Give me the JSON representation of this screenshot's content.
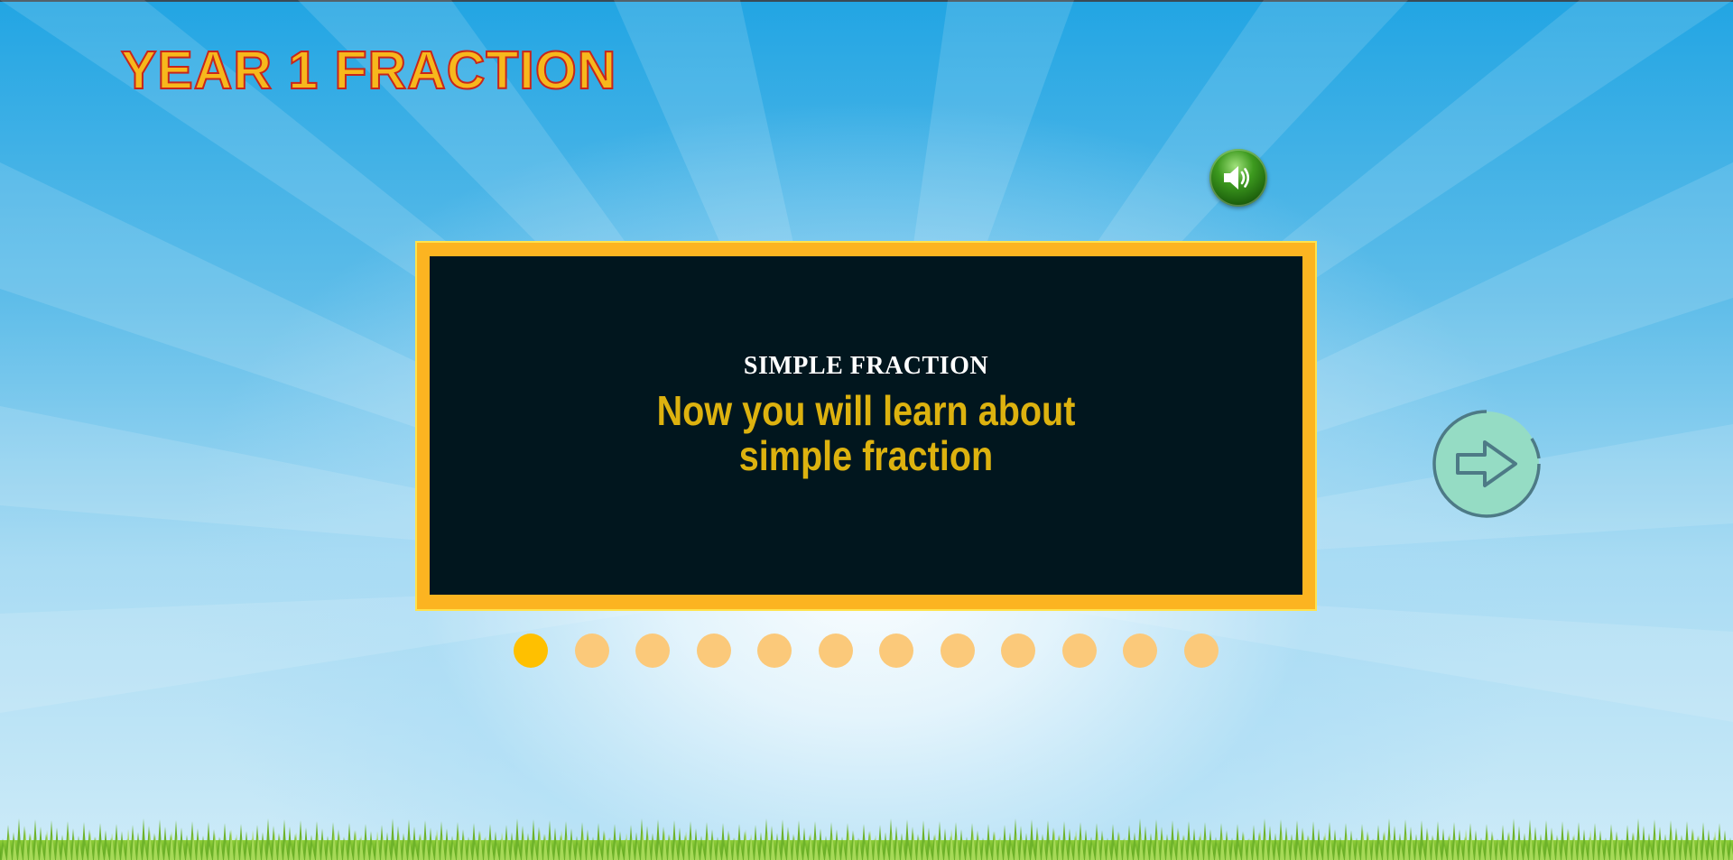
{
  "header": {
    "title": "YEAR 1 FRACTION"
  },
  "controls": {
    "sound_icon": "speaker-icon",
    "next_icon": "arrow-right-icon"
  },
  "board": {
    "heading": "SIMPLE FRACTION",
    "text_line1": "Now you will learn about",
    "text_line2": "simple fraction"
  },
  "pagination": {
    "total": 12,
    "current": 1
  },
  "colors": {
    "title_fill": "#f7b81c",
    "title_stroke": "#c8261b",
    "board_frame": "#fcb421",
    "board_background": "#01161e",
    "board_text": "#ddb20f",
    "dot_active": "#ffc000",
    "dot_inactive": "#fbc97a",
    "sound_button": "#2e7d13",
    "next_button": "#90dcc2"
  }
}
